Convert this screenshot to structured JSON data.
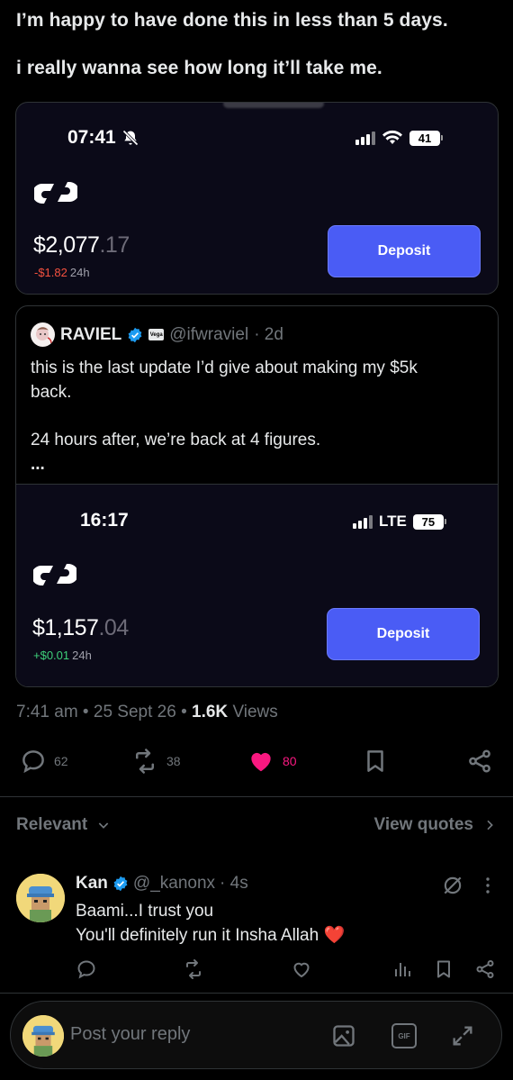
{
  "post": {
    "line1": "I’m happy to have done this in less than 5 days.",
    "line2": "i really wanna see how long it’ll take me."
  },
  "wallet_top": {
    "time": "07:41",
    "battery": "41",
    "balance_main": "$2,077",
    "balance_cents": ".17",
    "change": "-$1.82",
    "period": "24h",
    "deposit_label": "Deposit"
  },
  "quote": {
    "name": "RAVIEL",
    "affiliate_badge": "Vega",
    "handle": "@ifwraviel",
    "age": "· 2d",
    "line1": "this is the last update I’d give about making my $5k",
    "line2": "back.",
    "line3": "24 hours after, we’re back at 4 figures.",
    "ellipsis": "...",
    "wallet": {
      "time": "16:17",
      "network": "LTE",
      "battery": "75",
      "balance_main": "$1,157",
      "balance_cents": ".04",
      "change": "+$0.01",
      "period": "24h",
      "deposit_label": "Deposit"
    }
  },
  "meta": {
    "time": "7:41 am",
    "date": "25 Sept 26",
    "views_count": "1.6K",
    "views_label": "Views"
  },
  "actions": {
    "replies": "62",
    "reposts": "38",
    "likes": "80"
  },
  "sort": {
    "relevant_label": "Relevant",
    "view_quotes_label": "View quotes"
  },
  "reply": {
    "name": "Kan",
    "handle": "@_kanonx",
    "age": "· 4s",
    "line1": "Baami...I trust you",
    "line2": "You'll definitely run it Insha Allah",
    "emoji": "❤️"
  },
  "composer": {
    "placeholder": "Post your reply",
    "gif_label": "GIF"
  },
  "colors": {
    "background": "#000000",
    "accent_blue": "#1d9bf0",
    "like_pink": "#f91880",
    "deposit_blue": "#4a5cf5",
    "muted": "#71767b"
  }
}
